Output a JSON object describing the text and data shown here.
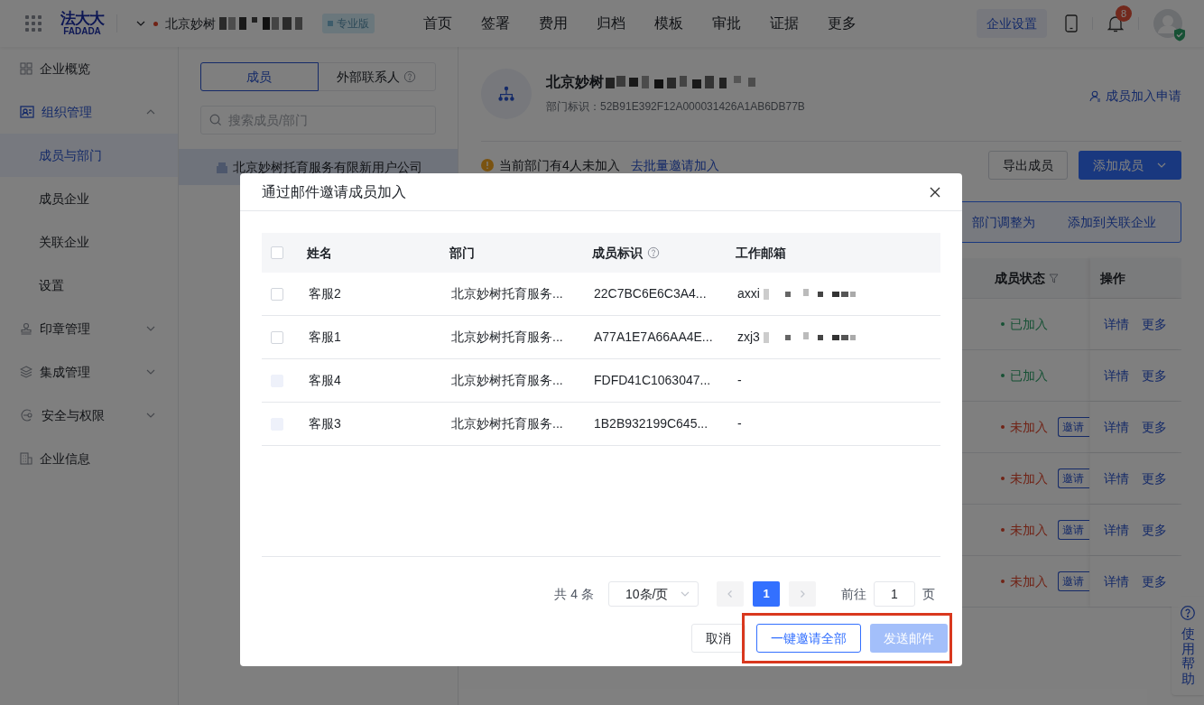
{
  "header": {
    "logo": {
      "wordmark": "法大大",
      "subtitle": "FADADA"
    },
    "company": "北京妙树",
    "edition": "专业版",
    "nav": [
      {
        "label": "首页"
      },
      {
        "label": "签署"
      },
      {
        "label": "费用"
      },
      {
        "label": "归档"
      },
      {
        "label": "模板"
      },
      {
        "label": "审批"
      },
      {
        "label": "证据"
      },
      {
        "label": "更多"
      }
    ],
    "settings_button": "企业设置",
    "notification_count": "8"
  },
  "sidebar": {
    "items": [
      {
        "label": "企业概览",
        "kind": "link",
        "selected": false
      },
      {
        "label": "组织管理",
        "kind": "group",
        "expanded": true,
        "children": [
          {
            "label": "成员与部门",
            "selected": true
          },
          {
            "label": "成员企业",
            "selected": false
          },
          {
            "label": "关联企业",
            "selected": false
          },
          {
            "label": "设置",
            "selected": false
          }
        ]
      },
      {
        "label": "印章管理",
        "kind": "group",
        "expanded": false
      },
      {
        "label": "集成管理",
        "kind": "group",
        "expanded": false
      },
      {
        "label": "安全与权限",
        "kind": "group",
        "expanded": false
      },
      {
        "label": "企业信息",
        "kind": "link",
        "selected": false
      }
    ]
  },
  "directory": {
    "tabs": [
      {
        "label": "成员",
        "selected": true,
        "help": false
      },
      {
        "label": "外部联系人",
        "selected": false,
        "help": true
      }
    ],
    "search": {
      "placeholder": "搜索成员/部门"
    },
    "tree": [
      {
        "label": "北京妙树托育服务有限新用户公司",
        "selected": true
      }
    ]
  },
  "department": {
    "name": "北京妙树",
    "id_line": "部门标识：52B91E392F12A000031426A1AB6DB77B",
    "join_requests": "成员加入申请",
    "notice": "当前部门有4人未加入",
    "notice_link": "去批量邀请加入",
    "export_button": "导出成员",
    "add_button": "添加成员",
    "batch_actions": [
      "部门调整为",
      "添加到关联企业"
    ]
  },
  "members_table": {
    "columns": [
      {
        "label": "成员状态",
        "filter": true
      },
      {
        "label": "操作",
        "filter": false
      }
    ],
    "rows": [
      {
        "status": "已加入",
        "joined": true,
        "actions": [
          "详情",
          "更多"
        ]
      },
      {
        "status": "已加入",
        "joined": true,
        "actions": [
          "详情",
          "更多"
        ]
      },
      {
        "status": "未加入",
        "joined": false,
        "invite": "邀请",
        "actions": [
          "详情",
          "更多"
        ]
      },
      {
        "status": "未加入",
        "joined": false,
        "invite": "邀请",
        "actions": [
          "详情",
          "更多"
        ]
      },
      {
        "status": "未加入",
        "joined": false,
        "invite": "邀请",
        "actions": [
          "详情",
          "更多"
        ]
      },
      {
        "status": "未加入",
        "joined": false,
        "invite": "邀请",
        "actions": [
          "详情",
          "更多"
        ]
      }
    ]
  },
  "help_widget": "使用帮助",
  "modal": {
    "title": "通过邮件邀请成员加入",
    "header_checkbox": {
      "checked": false
    },
    "columns": [
      {
        "label": "姓名",
        "help": false
      },
      {
        "label": "部门",
        "help": false
      },
      {
        "label": "成员标识",
        "help": true
      },
      {
        "label": "工作邮箱",
        "help": false
      }
    ],
    "rows": [
      {
        "checked": false,
        "disabled": false,
        "name": "客服2",
        "department": "北京妙树托育服务...",
        "member_id": "22C7BC6E6C3A4...",
        "email": "axxi",
        "email_redacted": true
      },
      {
        "checked": false,
        "disabled": false,
        "name": "客服1",
        "department": "北京妙树托育服务...",
        "member_id": "A77A1E7A66AA4E...",
        "email": "zxj3",
        "email_redacted": true
      },
      {
        "checked": false,
        "disabled": true,
        "name": "客服4",
        "department": "北京妙树托育服务...",
        "member_id": "FDFD41C1063047...",
        "email": "-",
        "email_redacted": false
      },
      {
        "checked": false,
        "disabled": true,
        "name": "客服3",
        "department": "北京妙树托育服务...",
        "member_id": "1B2B932199C645...",
        "email": "-",
        "email_redacted": false
      }
    ],
    "pagination": {
      "total": "共 4 条",
      "page_size": "10条/页",
      "pages": [
        {
          "label": "1",
          "selected": true
        }
      ],
      "goto_label": "前往",
      "goto_value": "1",
      "goto_suffix": "页"
    },
    "buttons": [
      {
        "label": "取消",
        "kind": "default",
        "disabled": false,
        "highlighted": false
      },
      {
        "label": "一键邀请全部",
        "kind": "outline",
        "disabled": false,
        "highlighted": true
      },
      {
        "label": "发送邮件",
        "kind": "primary",
        "disabled": true,
        "highlighted": true
      }
    ]
  }
}
